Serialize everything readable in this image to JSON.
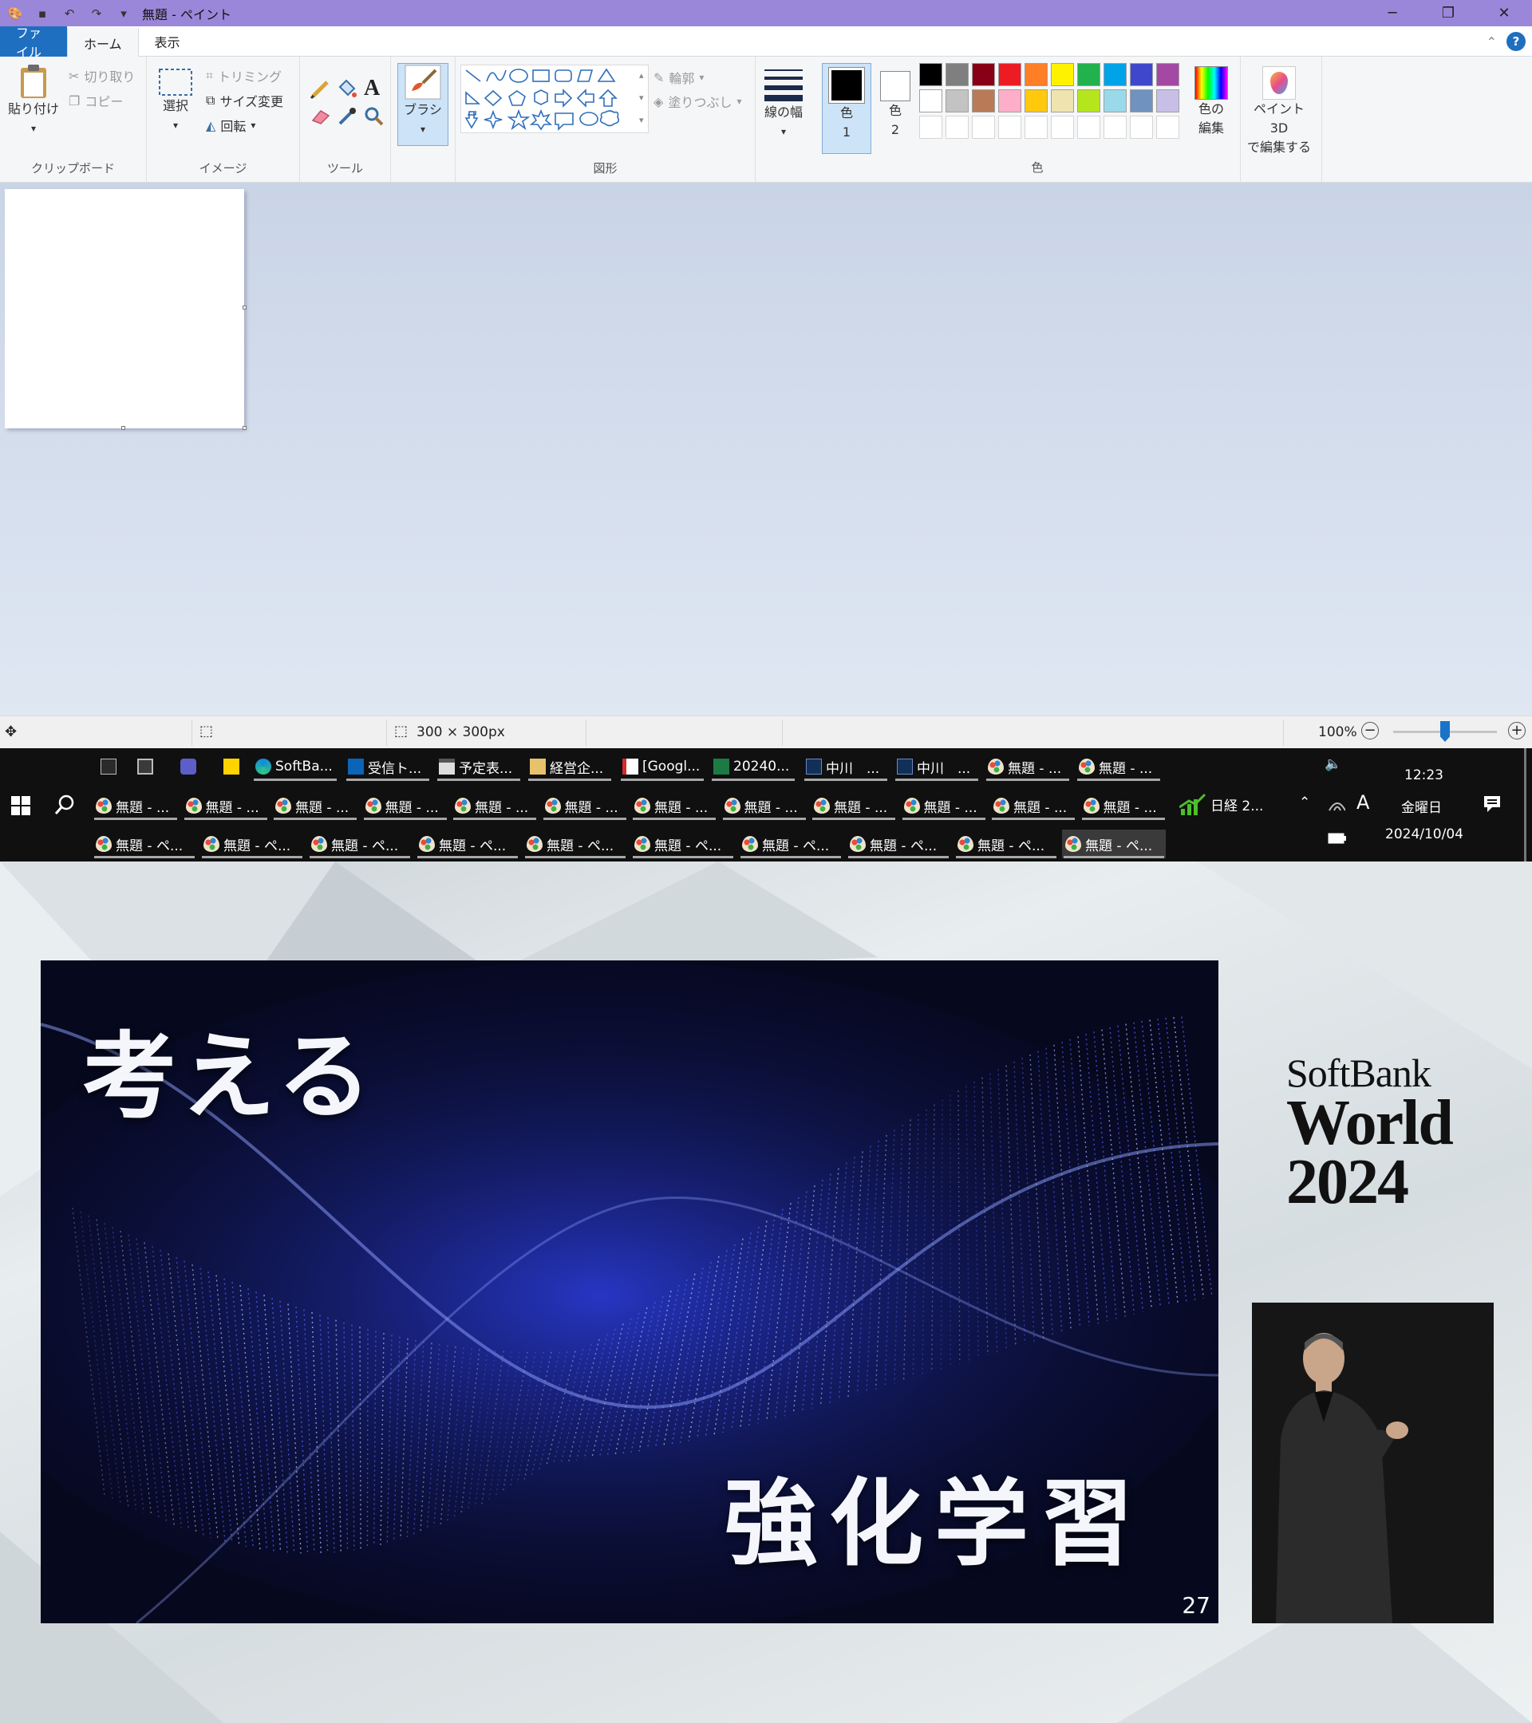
{
  "titlebar": {
    "title": "無題 - ペイント"
  },
  "tabs": {
    "file": "ファイル",
    "home": "ホーム",
    "view": "表示"
  },
  "ribbon": {
    "clipboard": {
      "paste": "貼り付け",
      "cut": "切り取り",
      "copy": "コピー",
      "label": "クリップボード"
    },
    "image": {
      "select": "選択",
      "crop": "トリミング",
      "resize": "サイズ変更",
      "rotate": "回転",
      "label": "イメージ"
    },
    "tools": {
      "label": "ツール"
    },
    "brush": {
      "label": "ブラシ"
    },
    "shapes": {
      "outline": "輪郭",
      "fill": "塗りつぶし",
      "label": "図形"
    },
    "size": {
      "label": "線の幅"
    },
    "color1": {
      "label1": "色",
      "label2": "1"
    },
    "color2": {
      "label1": "色",
      "label2": "2"
    },
    "colors_label": "色",
    "edit_colors": {
      "l1": "色の",
      "l2": "編集"
    },
    "paint3d": {
      "l1": "ペイント 3D",
      "l2": "で編集する"
    },
    "palette_row1": [
      "#000000",
      "#7f7f7f",
      "#880015",
      "#ed1c24",
      "#ff7f27",
      "#fff200",
      "#22b14c",
      "#00a2e8",
      "#3f48cc",
      "#a349a4"
    ],
    "palette_row2": [
      "#ffffff",
      "#c3c3c3",
      "#b97a57",
      "#ffaec9",
      "#ffc90e",
      "#efe4b0",
      "#b5e61d",
      "#99d9ea",
      "#7092be",
      "#c8bfe7"
    ]
  },
  "status": {
    "canvas_size": "300 × 300px",
    "zoom": "100%",
    "zoom_level": 0.5
  },
  "taskbar": {
    "row1": [
      {
        "label": "",
        "icon": "terminal-icon"
      },
      {
        "label": "",
        "icon": "window-icon"
      },
      {
        "label": "",
        "icon": "teams-icon"
      },
      {
        "label": "",
        "icon": "sticky-notes-icon"
      },
      {
        "label": "SoftBa...",
        "icon": "edge-icon"
      },
      {
        "label": "受信ト...",
        "icon": "outlook-icon"
      },
      {
        "label": "予定表...",
        "icon": "calendar-icon"
      },
      {
        "label": "経営企...",
        "icon": "mail-icon"
      },
      {
        "label": "[Googl...",
        "icon": "pdf-icon"
      },
      {
        "label": "20240...",
        "icon": "excel-icon"
      },
      {
        "label": "中川　...",
        "icon": "app-icon"
      },
      {
        "label": "中川　...",
        "icon": "app-icon"
      },
      {
        "label": "無題 - ...",
        "icon": "paint-icon"
      },
      {
        "label": "無題 - ...",
        "icon": "paint-icon"
      }
    ],
    "row2_label": "無題 - ...",
    "row2_count": 12,
    "row3_label": "無題 - ペ...",
    "row3_count": 10,
    "stock": "日経 2...",
    "time": "12:23",
    "weekday": "金曜日",
    "date": "2024/10/04",
    "ime": "A"
  },
  "presentation": {
    "title": "考える",
    "subtitle": "強化学習",
    "slide_number": "27",
    "brand": {
      "line1": "SoftBank",
      "line2": "World",
      "line3": "2024"
    }
  }
}
